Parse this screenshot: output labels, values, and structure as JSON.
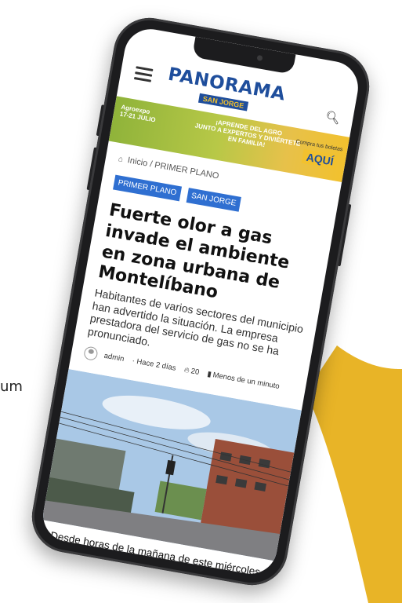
{
  "background": {
    "partial_text": "um",
    "accent_color": "#e8b427"
  },
  "header": {
    "logo_main": "PANORAMA",
    "logo_sub": "SAN JORGE"
  },
  "ad": {
    "left_line1": "Agroexpo",
    "left_line2": "17-21 JULIO",
    "center_line1": "¡APRENDE DEL AGRO",
    "center_line2": "JUNTO A EXPERTOS Y DIVIÉRTETE",
    "center_line3": "EN FAMILIA!",
    "right_small": "Compra tus boletas",
    "right_big": "AQUÍ"
  },
  "breadcrumb": {
    "home": "Inicio",
    "separator": "/",
    "section": "PRIMER PLANO"
  },
  "tags": [
    "PRIMER PLANO",
    "SAN JORGE"
  ],
  "article": {
    "title": "Fuerte olor a gas invade el ambiente en zona urbana de Montelíbano",
    "lead": "Habitantes de varios sectores del municipio han advertido la situación. La empresa prestadora del servicio de gas no se ha pronunciado.",
    "author": "admin",
    "time": "· Hace 2 días",
    "views": "20",
    "read_time": "Menos de un minuto",
    "body_start": "Desde horas de la mañana de este miércoles,"
  },
  "colors": {
    "brand_blue": "#1f4e9c",
    "tag_blue": "#2f6fd1",
    "brand_yellow": "#f2c12e"
  }
}
